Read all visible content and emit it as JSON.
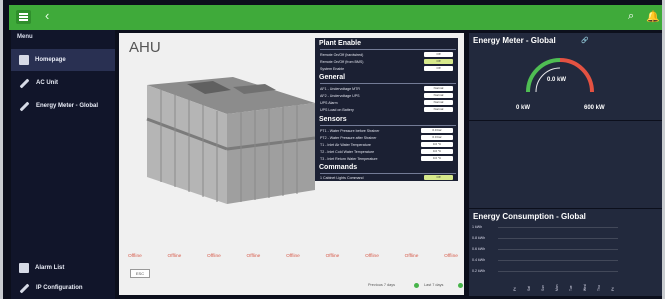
{
  "topbar": {
    "back_icon": "chevron-left-icon",
    "search_icon": "search-icon",
    "bell_icon": "bell-icon"
  },
  "sidebar": {
    "title": "Menu",
    "items": [
      {
        "label": "Homepage",
        "icon": "home-icon"
      },
      {
        "label": "AC Unit",
        "icon": "pencil-icon"
      },
      {
        "label": "Energy Meter - Global",
        "icon": "pencil-icon"
      }
    ],
    "bottom_items": [
      {
        "label": "Alarm List",
        "icon": "alarm-icon"
      },
      {
        "label": "IP Configuration",
        "icon": "pencil-icon"
      }
    ]
  },
  "main": {
    "title": "AHU",
    "plant_enable": {
      "title": "Plant Enable",
      "rows": [
        {
          "label": "Remote On/Off (hardwired)",
          "value": "Off"
        },
        {
          "label": "Remote On/Off (from BMS)",
          "value": "Off"
        },
        {
          "label": "System Enable",
          "value": "Off"
        }
      ]
    },
    "general": {
      "title": "General",
      "rows": [
        {
          "label": "AF1 - Undervoltage MTR",
          "value": "Normal"
        },
        {
          "label": "AF2 - Undervoltage UPS",
          "value": "Normal"
        },
        {
          "label": "UPS Alarm",
          "value": "Normal"
        },
        {
          "label": "UPS Load on Battery",
          "value": "Normal"
        }
      ]
    },
    "sensors": {
      "title": "Sensors",
      "rows": [
        {
          "label": "PT1 - Water Pressure before Strainer",
          "value": "0.0 bar"
        },
        {
          "label": "PT2 - Water Pressure after Strainer",
          "value": "0.0 bar"
        },
        {
          "label": "T1 - Inlet Air Water Temperature",
          "value": "0.0 °C"
        },
        {
          "label": "T2 - Inlet Cold Water Temperature",
          "value": "0.0 °C"
        },
        {
          "label": "T3 - Inlet Return Water Temperature",
          "value": "0.0 °C"
        }
      ]
    },
    "commands": {
      "title": "Commands",
      "rows": [
        {
          "label": "1 Cabinet Lights Command",
          "value": "Off"
        }
      ]
    },
    "statuses": [
      "Offline",
      "Offline",
      "Offline",
      "Offline",
      "Offline",
      "Offline",
      "Offline",
      "Offline",
      "Offline"
    ],
    "small_button": "ESC",
    "previous_label": "Previous 7 days",
    "last_label": "Last 7 days"
  },
  "energy_meter": {
    "title": "Energy Meter - Global",
    "link_icon": "link-icon",
    "center": "0.0 kW",
    "min": "0 kW",
    "max": "600 kW",
    "gauge_fraction": 0.0
  },
  "consumption": {
    "title": "Energy Consumption - Global",
    "yticks": [
      "1 kWh",
      "0.8 kWh",
      "0.6 kWh",
      "0.4 kWh",
      "0.2 kWh"
    ],
    "xticks": [
      "Fri",
      "Sat",
      "Sun",
      "Mon",
      "Tue",
      "Wed",
      "Thu",
      "Fri"
    ]
  },
  "colors": {
    "topbar": "#3faa3a",
    "sidebar": "#11152a",
    "panel": "#1b2033",
    "status_offline": "#d75b4a",
    "gauge_green": "#4fbe53",
    "gauge_red": "#e45242"
  }
}
